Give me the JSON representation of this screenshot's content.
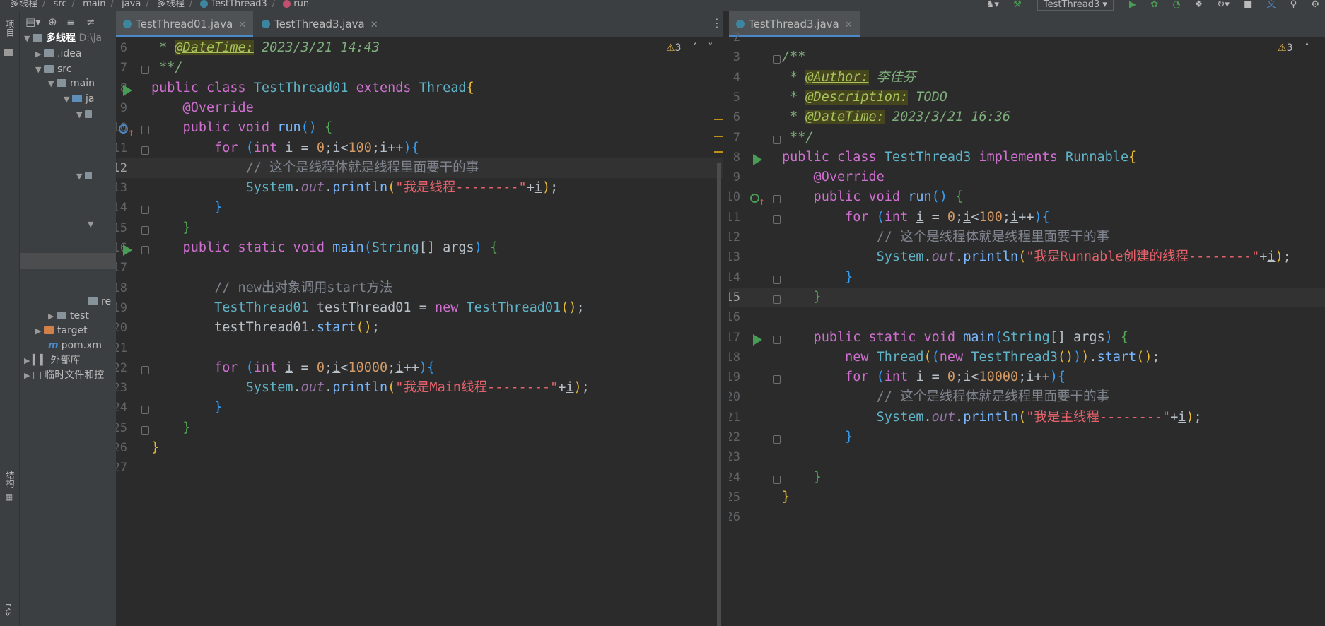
{
  "navbar": {
    "crumbs": [
      "多线程",
      "src",
      "main",
      "java",
      "多线程",
      "TestThread3",
      "run"
    ],
    "run_config": "TestThread3"
  },
  "toolstrip": {
    "project_label": "项目",
    "structure_label": "结构",
    "bookmarks_label": "rks"
  },
  "project": {
    "root_name": "多线程",
    "root_path": "D:\\ja",
    "items": [
      ".idea",
      "src",
      "main",
      "ja",
      "re",
      "test",
      "target",
      "pom.xm",
      "外部库",
      "临时文件和控"
    ]
  },
  "left_editor": {
    "tabs": [
      {
        "label": "TestThread01.java",
        "active": true
      },
      {
        "label": "TestThread3.java",
        "active": false
      }
    ],
    "warnings": "3",
    "current_line": 12,
    "lines": [
      {
        "n": "6",
        "parts": [
          [
            "dc",
            " * "
          ],
          [
            "tg",
            "@DateTime:"
          ],
          [
            "dc",
            " 2023/3/21 14:43"
          ]
        ]
      },
      {
        "n": "7",
        "parts": [
          [
            "dc",
            " **/"
          ]
        ]
      },
      {
        "n": "8",
        "parts": [
          [
            "k",
            "public class "
          ],
          [
            "ty",
            "TestThread01 "
          ],
          [
            "k",
            "extends "
          ],
          [
            "ty",
            "Thread"
          ],
          [
            "b",
            "{"
          ]
        ]
      },
      {
        "n": "9",
        "parts": [
          [
            "a",
            "    @Override"
          ]
        ]
      },
      {
        "n": "10",
        "parts": [
          [
            "k",
            "    public void "
          ],
          [
            "fcall",
            "run"
          ],
          [
            "b3",
            "() "
          ],
          [
            "b2",
            "{"
          ]
        ]
      },
      {
        "n": "11",
        "parts": [
          [
            "k",
            "        for "
          ],
          [
            "b3",
            "("
          ],
          [
            "k",
            "int "
          ],
          [
            "pl u",
            "i"
          ],
          [
            "pl",
            " = "
          ],
          [
            "nm",
            "0"
          ],
          [
            "pl",
            ";"
          ],
          [
            "pl u",
            "i"
          ],
          [
            "pl",
            "<"
          ],
          [
            "nm",
            "100"
          ],
          [
            "pl",
            ";"
          ],
          [
            "pl u",
            "i"
          ],
          [
            "pl",
            "++"
          ],
          [
            "b3",
            ")"
          ],
          [
            "b3",
            "{"
          ]
        ]
      },
      {
        "n": "12",
        "parts": [
          [
            "cm",
            "            // 这个是线程体就是线程里面要干的事"
          ]
        ]
      },
      {
        "n": "13",
        "parts": [
          [
            "ty",
            "            System"
          ],
          [
            "pl",
            "."
          ],
          [
            "v",
            "out"
          ],
          [
            "pl",
            "."
          ],
          [
            "fcall",
            "println"
          ],
          [
            "b",
            "("
          ],
          [
            "s",
            "\"我是线程--------\""
          ],
          [
            "pl",
            "+"
          ],
          [
            "pl u",
            "i"
          ],
          [
            "b",
            ")"
          ],
          [
            "pl",
            ";"
          ]
        ]
      },
      {
        "n": "14",
        "parts": [
          [
            "b3",
            "        }"
          ]
        ]
      },
      {
        "n": "15",
        "parts": [
          [
            "b2",
            "    }"
          ]
        ]
      },
      {
        "n": "16",
        "parts": [
          [
            "k",
            "    public static void "
          ],
          [
            "fcall",
            "main"
          ],
          [
            "b3",
            "("
          ],
          [
            "ty",
            "String"
          ],
          [
            "pl",
            "[] args"
          ],
          [
            "b3",
            ") "
          ],
          [
            "b2",
            "{"
          ]
        ]
      },
      {
        "n": "17",
        "parts": [
          [
            "pl",
            ""
          ]
        ]
      },
      {
        "n": "18",
        "parts": [
          [
            "cm",
            "        // new出对象调用start方法"
          ]
        ]
      },
      {
        "n": "19",
        "parts": [
          [
            "ty",
            "        TestThread01 "
          ],
          [
            "pl",
            "testThread01 = "
          ],
          [
            "k",
            "new "
          ],
          [
            "ty",
            "TestThread01"
          ],
          [
            "b",
            "()"
          ],
          [
            "pl",
            ";"
          ]
        ]
      },
      {
        "n": "20",
        "parts": [
          [
            "pl",
            "        testThread01."
          ],
          [
            "fcall",
            "start"
          ],
          [
            "b",
            "()"
          ],
          [
            "pl",
            ";"
          ]
        ]
      },
      {
        "n": "21",
        "parts": [
          [
            "pl",
            ""
          ]
        ]
      },
      {
        "n": "22",
        "parts": [
          [
            "k",
            "        for "
          ],
          [
            "b3",
            "("
          ],
          [
            "k",
            "int "
          ],
          [
            "pl u",
            "i"
          ],
          [
            "pl",
            " = "
          ],
          [
            "nm",
            "0"
          ],
          [
            "pl",
            ";"
          ],
          [
            "pl u",
            "i"
          ],
          [
            "pl",
            "<"
          ],
          [
            "nm",
            "10000"
          ],
          [
            "pl",
            ";"
          ],
          [
            "pl u",
            "i"
          ],
          [
            "pl",
            "++"
          ],
          [
            "b3",
            ")"
          ],
          [
            "b3",
            "{"
          ]
        ]
      },
      {
        "n": "23",
        "parts": [
          [
            "ty",
            "            System"
          ],
          [
            "pl",
            "."
          ],
          [
            "v",
            "out"
          ],
          [
            "pl",
            "."
          ],
          [
            "fcall",
            "println"
          ],
          [
            "b",
            "("
          ],
          [
            "s",
            "\"我是Main线程--------\""
          ],
          [
            "pl",
            "+"
          ],
          [
            "pl u",
            "i"
          ],
          [
            "b",
            ")"
          ],
          [
            "pl",
            ";"
          ]
        ]
      },
      {
        "n": "24",
        "parts": [
          [
            "b3",
            "        }"
          ]
        ]
      },
      {
        "n": "25",
        "parts": [
          [
            "b2",
            "    }"
          ]
        ]
      },
      {
        "n": "26",
        "parts": [
          [
            "b",
            "}"
          ]
        ]
      },
      {
        "n": "27",
        "parts": [
          [
            "pl",
            ""
          ]
        ]
      }
    ]
  },
  "right_editor": {
    "tabs": [
      {
        "label": "TestThread3.java",
        "active": true
      }
    ],
    "warnings": "3",
    "current_line": 15,
    "lines": [
      {
        "n": "2",
        "parts": [
          [
            "pl",
            ""
          ]
        ]
      },
      {
        "n": "3",
        "parts": [
          [
            "dc",
            "/**"
          ]
        ]
      },
      {
        "n": "4",
        "parts": [
          [
            "dc",
            " * "
          ],
          [
            "tg",
            "@Author:"
          ],
          [
            "dc",
            " 李佳芬"
          ]
        ]
      },
      {
        "n": "5",
        "parts": [
          [
            "dc",
            " * "
          ],
          [
            "tg",
            "@Description:"
          ],
          [
            "dc",
            " TODO"
          ]
        ]
      },
      {
        "n": "6",
        "parts": [
          [
            "dc",
            " * "
          ],
          [
            "tg",
            "@DateTime:"
          ],
          [
            "dc",
            " 2023/3/21 16:36"
          ]
        ]
      },
      {
        "n": "7",
        "parts": [
          [
            "dc",
            " **/"
          ]
        ]
      },
      {
        "n": "8",
        "parts": [
          [
            "k",
            "public class "
          ],
          [
            "ty",
            "TestThread3 "
          ],
          [
            "k",
            "implements "
          ],
          [
            "ty",
            "Runnable"
          ],
          [
            "b",
            "{"
          ]
        ]
      },
      {
        "n": "9",
        "parts": [
          [
            "a",
            "    @Override"
          ]
        ]
      },
      {
        "n": "10",
        "parts": [
          [
            "k",
            "    public void "
          ],
          [
            "fcall",
            "run"
          ],
          [
            "b3",
            "() "
          ],
          [
            "b2",
            "{"
          ]
        ]
      },
      {
        "n": "11",
        "parts": [
          [
            "k",
            "        for "
          ],
          [
            "b3",
            "("
          ],
          [
            "k",
            "int "
          ],
          [
            "pl u",
            "i"
          ],
          [
            "pl",
            " = "
          ],
          [
            "nm",
            "0"
          ],
          [
            "pl",
            ";"
          ],
          [
            "pl u",
            "i"
          ],
          [
            "pl",
            "<"
          ],
          [
            "nm",
            "100"
          ],
          [
            "pl",
            ";"
          ],
          [
            "pl u",
            "i"
          ],
          [
            "pl",
            "++"
          ],
          [
            "b3",
            ")"
          ],
          [
            "b3",
            "{"
          ]
        ]
      },
      {
        "n": "12",
        "parts": [
          [
            "cm",
            "            // 这个是线程体就是线程里面要干的事"
          ]
        ]
      },
      {
        "n": "13",
        "parts": [
          [
            "ty",
            "            System"
          ],
          [
            "pl",
            "."
          ],
          [
            "v",
            "out"
          ],
          [
            "pl",
            "."
          ],
          [
            "fcall",
            "println"
          ],
          [
            "b",
            "("
          ],
          [
            "s",
            "\"我是Runnable创建的线程--------\""
          ],
          [
            "pl",
            "+"
          ],
          [
            "pl u",
            "i"
          ],
          [
            "b",
            ")"
          ],
          [
            "pl",
            ";"
          ]
        ]
      },
      {
        "n": "14",
        "parts": [
          [
            "b3",
            "        }"
          ]
        ]
      },
      {
        "n": "15",
        "parts": [
          [
            "b2",
            "    }"
          ]
        ]
      },
      {
        "n": "16",
        "parts": [
          [
            "pl",
            ""
          ]
        ]
      },
      {
        "n": "17",
        "parts": [
          [
            "k",
            "    public static void "
          ],
          [
            "fcall",
            "main"
          ],
          [
            "b3",
            "("
          ],
          [
            "ty",
            "String"
          ],
          [
            "pl",
            "[] args"
          ],
          [
            "b3",
            ") "
          ],
          [
            "b2",
            "{"
          ]
        ]
      },
      {
        "n": "18",
        "parts": [
          [
            "k",
            "        new "
          ],
          [
            "ty",
            "Thread"
          ],
          [
            "b",
            "("
          ],
          [
            "b3",
            "("
          ],
          [
            "k",
            "new "
          ],
          [
            "ty",
            "TestThread3"
          ],
          [
            "b",
            "()"
          ],
          [
            "b3",
            ")"
          ],
          [
            "b",
            ")"
          ],
          [
            "pl",
            "."
          ],
          [
            "fcall",
            "start"
          ],
          [
            "b",
            "()"
          ],
          [
            "pl",
            ";"
          ]
        ]
      },
      {
        "n": "19",
        "parts": [
          [
            "k",
            "        for "
          ],
          [
            "b3",
            "("
          ],
          [
            "k",
            "int "
          ],
          [
            "pl u",
            "i"
          ],
          [
            "pl",
            " = "
          ],
          [
            "nm",
            "0"
          ],
          [
            "pl",
            ";"
          ],
          [
            "pl u",
            "i"
          ],
          [
            "pl",
            "<"
          ],
          [
            "nm",
            "10000"
          ],
          [
            "pl",
            ";"
          ],
          [
            "pl u",
            "i"
          ],
          [
            "pl",
            "++"
          ],
          [
            "b3",
            ")"
          ],
          [
            "b3",
            "{"
          ]
        ]
      },
      {
        "n": "20",
        "parts": [
          [
            "cm",
            "            // 这个是线程体就是线程里面要干的事"
          ]
        ]
      },
      {
        "n": "21",
        "parts": [
          [
            "ty",
            "            System"
          ],
          [
            "pl",
            "."
          ],
          [
            "v",
            "out"
          ],
          [
            "pl",
            "."
          ],
          [
            "fcall",
            "println"
          ],
          [
            "b",
            "("
          ],
          [
            "s",
            "\"我是主线程--------\""
          ],
          [
            "pl",
            "+"
          ],
          [
            "pl u",
            "i"
          ],
          [
            "b",
            ")"
          ],
          [
            "pl",
            ";"
          ]
        ]
      },
      {
        "n": "22",
        "parts": [
          [
            "b3",
            "        }"
          ]
        ]
      },
      {
        "n": "23",
        "parts": [
          [
            "pl",
            ""
          ]
        ]
      },
      {
        "n": "24",
        "parts": [
          [
            "b2",
            "    }"
          ]
        ]
      },
      {
        "n": "25",
        "parts": [
          [
            "b",
            "}"
          ]
        ]
      },
      {
        "n": "26",
        "parts": [
          [
            "pl",
            ""
          ]
        ]
      }
    ]
  }
}
